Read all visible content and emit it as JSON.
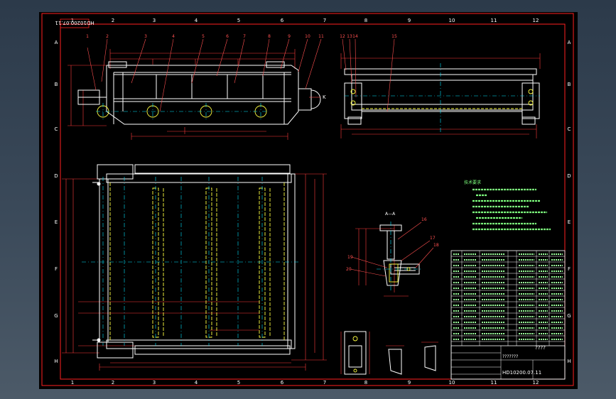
{
  "drawing": {
    "code": "HD10200.07.11",
    "title_block_name": "????",
    "title_block_subtitle": "???????",
    "notes_heading": "技术要求",
    "section_label": "A—A",
    "view_marker": "K",
    "column_numbers": [
      "1",
      "2",
      "3",
      "4",
      "5",
      "6",
      "7",
      "8",
      "9",
      "10",
      "11",
      "12"
    ],
    "row_letters": [
      "A",
      "B",
      "C",
      "D",
      "E",
      "F",
      "G",
      "H"
    ],
    "callouts_top": [
      "1",
      "2",
      "3",
      "4",
      "5",
      "6",
      "7",
      "8",
      "9",
      "10",
      "11"
    ],
    "callouts_side": [
      "12",
      "13",
      "14",
      "15"
    ],
    "callouts_section": [
      "16",
      "17",
      "18",
      "19",
      "20"
    ]
  },
  "colors": {
    "background": "#000000",
    "border": "#ff2020",
    "outline": "#ffffff",
    "dimension": "#ff3b3b",
    "centerline": "#00e5ff",
    "hidden": "#ffff40",
    "callout": "#ff5050",
    "notes": "#7dff7d",
    "table_text": "#9cff9c"
  }
}
